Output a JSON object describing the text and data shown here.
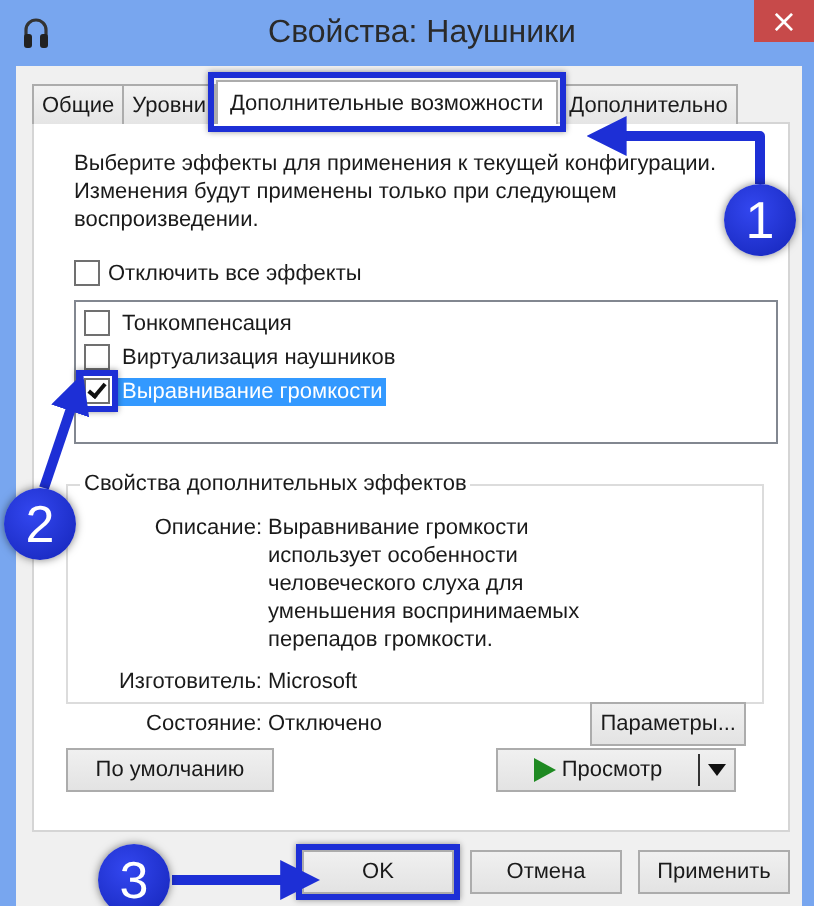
{
  "window": {
    "title": "Свойства: Наушники",
    "close": "×"
  },
  "tabs": [
    {
      "label": "Общие",
      "selected": false,
      "highlighted": false
    },
    {
      "label": "Уровни",
      "selected": false,
      "highlighted": false
    },
    {
      "label": "Дополнительные возможности",
      "selected": true,
      "highlighted": true
    },
    {
      "label": "Дополнительно",
      "selected": false,
      "highlighted": false
    }
  ],
  "description": "Выберите эффекты для применения к текущей конфигурации. Изменения будут применены только при следующем воспроизведении.",
  "disable_all": {
    "label": "Отключить все эффекты",
    "checked": false
  },
  "effects": [
    {
      "label": "Тонкомпенсация",
      "checked": false,
      "selected": false,
      "highlighted": false
    },
    {
      "label": "Виртуализация наушников",
      "checked": false,
      "selected": false,
      "highlighted": false
    },
    {
      "label": "Выравнивание громкости",
      "checked": true,
      "selected": true,
      "highlighted": true
    }
  ],
  "effect_properties": {
    "title": "Свойства дополнительных эффектов",
    "fields": [
      {
        "label": "Описание:",
        "value": "Выравнивание громкости использует особенности человеческого слуха для уменьшения воспринимаемых перепадов громкости."
      },
      {
        "label": "Изготовитель:",
        "value": "Microsoft"
      },
      {
        "label": "Состояние:",
        "value": "Отключено"
      }
    ],
    "settings_button": "Параметры..."
  },
  "default_button": "По умолчанию",
  "preview_button": "Просмотр",
  "buttons": [
    {
      "label": "OK",
      "highlighted": true
    },
    {
      "label": "Отмена",
      "highlighted": false
    },
    {
      "label": "Применить",
      "highlighted": false
    }
  ],
  "callouts": [
    {
      "label": "1"
    },
    {
      "label": "2"
    },
    {
      "label": "3"
    }
  ]
}
